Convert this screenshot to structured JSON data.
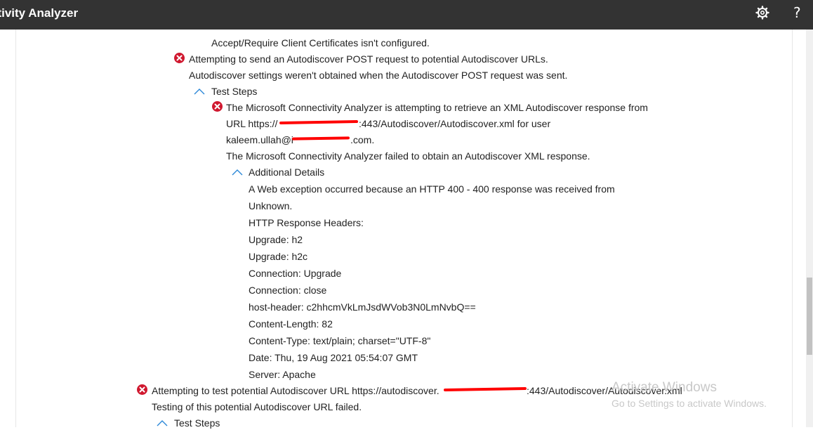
{
  "header": {
    "title": "Microsoft Remote Connectivity Analyzer",
    "title_visible": "ctivity Analyzer",
    "settings_icon": "gear-icon",
    "help_label": "?"
  },
  "results": [
    "Accept/Require Client Certificates isn't configured.",
    "Attempting to send an Autodiscover POST request to potential Autodiscover URLs.",
    "Autodiscover settings weren't obtained when the Autodiscover POST request was sent.",
    "Test Steps",
    "The Microsoft Connectivity Analyzer is attempting to retrieve an XML Autodiscover response from",
    "URL https://",
    ":443/Autodiscover/Autodiscover.xml for user",
    "kaleem.ullah@i",
    ".com.",
    "The Microsoft Connectivity Analyzer failed to obtain an Autodiscover XML response.",
    "Additional Details",
    "A Web exception occurred because an HTTP 400 - 400 response was received from",
    "Unknown.",
    "HTTP Response Headers:",
    "Upgrade: h2",
    "Upgrade: h2c",
    "Connection: Upgrade",
    "Connection: close",
    "host-header: c2hhcmVkLmJsdWVob3N0LmNvbQ==",
    "Content-Length: 82",
    "Content-Type: text/plain; charset=\"UTF-8\"",
    "Date: Thu, 19 Aug 2021 05:54:07 GMT",
    "Server: Apache",
    "Attempting to test potential Autodiscover URL https://autodiscover.",
    ":443/Autodiscover/Autodiscover.xml",
    "Testing of this potential Autodiscover URL failed.",
    "Test Steps"
  ],
  "watermark": {
    "title": "Activate Windows",
    "subtitle": "Go to Settings to activate Windows."
  },
  "colors": {
    "topbar": "#333333",
    "error": "#d0182f",
    "chevron": "#2b88d8",
    "redaction": "#ff0000"
  }
}
